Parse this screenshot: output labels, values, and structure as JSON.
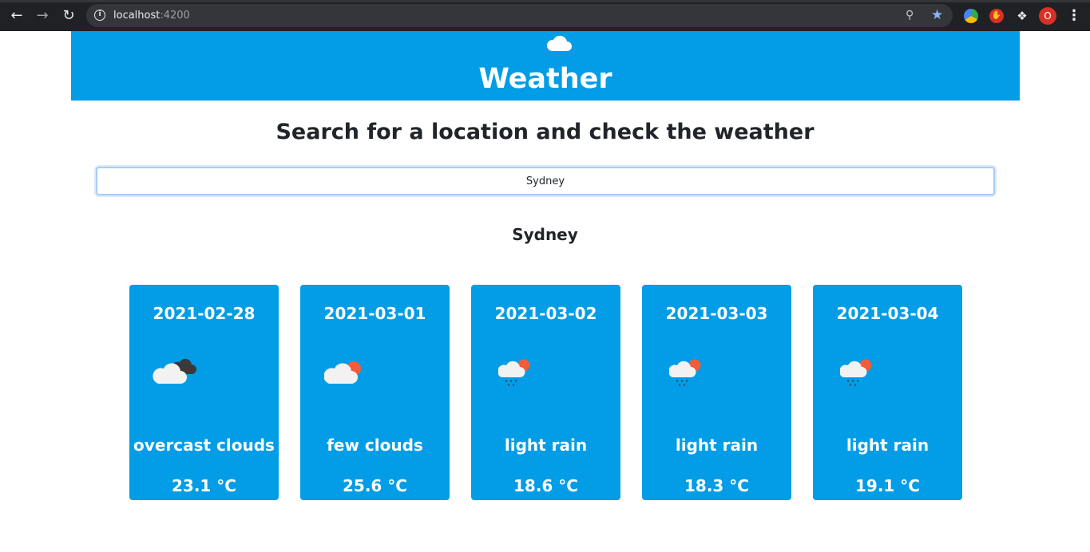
{
  "browser": {
    "url_host": "localhost",
    "url_port": ":4200",
    "profile_initial": "O"
  },
  "header": {
    "title": "Weather",
    "icon": "cloud-icon"
  },
  "subtitle": "Search for a location and check the weather",
  "search": {
    "value": "Sydney"
  },
  "location": "Sydney",
  "colors": {
    "primary": "#029de6",
    "text_dark": "#212529",
    "chrome": "#202124"
  },
  "forecast": [
    {
      "date": "2021-02-28",
      "icon": "overcast-clouds-icon",
      "description": "overcast clouds",
      "temperature": "23.1 °C"
    },
    {
      "date": "2021-03-01",
      "icon": "few-clouds-icon",
      "description": "few clouds",
      "temperature": "25.6 °C"
    },
    {
      "date": "2021-03-02",
      "icon": "light-rain-icon",
      "description": "light rain",
      "temperature": "18.6 °C"
    },
    {
      "date": "2021-03-03",
      "icon": "light-rain-icon",
      "description": "light rain",
      "temperature": "18.3 °C"
    },
    {
      "date": "2021-03-04",
      "icon": "light-rain-icon",
      "description": "light rain",
      "temperature": "19.1 °C"
    }
  ]
}
